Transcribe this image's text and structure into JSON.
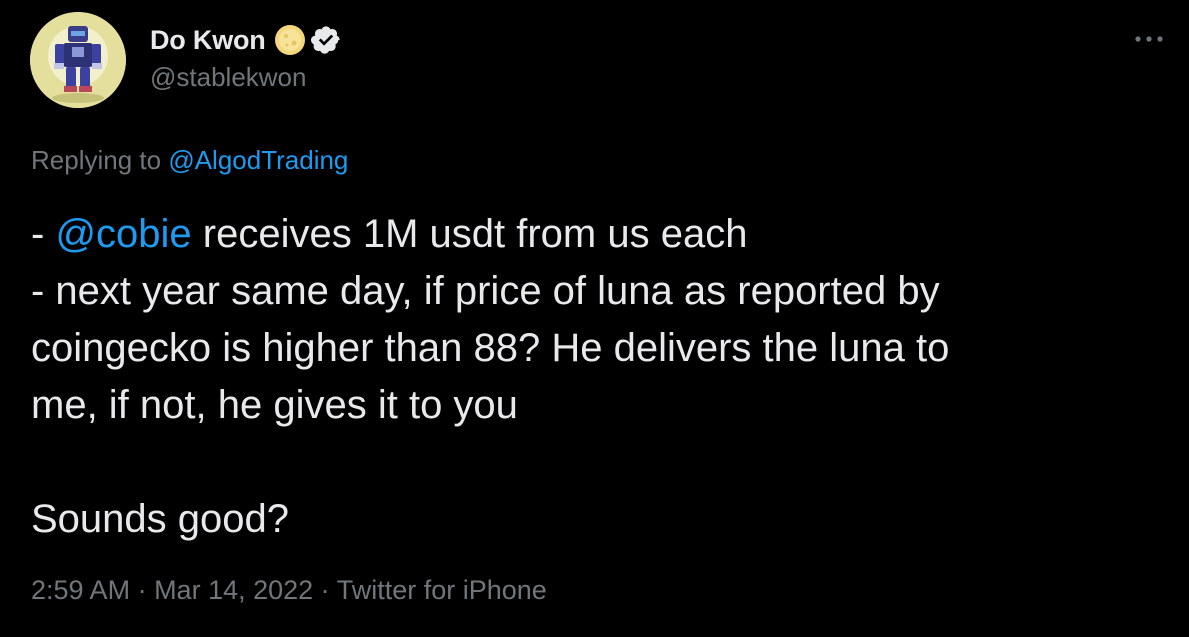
{
  "author": {
    "display_name": "Do Kwon",
    "handle": "@stablekwon",
    "badges": [
      "coin-icon",
      "verified-icon"
    ]
  },
  "reply": {
    "prefix": "Replying to ",
    "target": "@AlgodTrading"
  },
  "tweet": {
    "line1_prefix": "- ",
    "line1_mention": "@cobie",
    "line1_rest": " receives 1M usdt from us each",
    "line2": "- next year same day, if price of luna as reported by",
    "line3": "coingecko is higher than 88? He delivers the luna to",
    "line4": "me, if not, he gives it to you",
    "line5": "Sounds good?"
  },
  "meta": {
    "time": "2:59 AM",
    "sep1": " · ",
    "date": "Mar 14, 2022",
    "sep2": " · ",
    "source": "Twitter for iPhone"
  },
  "colors": {
    "background": "#000000",
    "text": "#e7e9ea",
    "muted": "#71767b",
    "link": "#1d9bf0",
    "coin": "#f5d77a"
  },
  "icons": {
    "more": "more-dots-icon"
  }
}
